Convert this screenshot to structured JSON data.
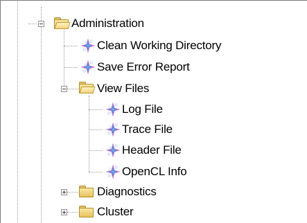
{
  "tree": {
    "items": [
      {
        "label": "Administration",
        "type": "folder",
        "expanded": true
      },
      {
        "label": "Clean Working Directory",
        "type": "action"
      },
      {
        "label": "Save Error Report",
        "type": "action"
      },
      {
        "label": "View Files",
        "type": "folder",
        "expanded": true
      },
      {
        "label": "Log File",
        "type": "action"
      },
      {
        "label": "Trace File",
        "type": "action"
      },
      {
        "label": "Header File",
        "type": "action"
      },
      {
        "label": "OpenCL Info",
        "type": "action"
      },
      {
        "label": "Diagnostics",
        "type": "folder",
        "expanded": false
      },
      {
        "label": "Cluster",
        "type": "folder",
        "expanded": false
      }
    ]
  },
  "colors": {
    "border": "#7a7a7a",
    "tree_lines": "#9a9a9a",
    "folder_fill": "#f3d27a",
    "folder_edge": "#b38d2c",
    "sparkle_blue": "#3f8ee0",
    "sparkle_pink": "#d66ad6"
  },
  "icons": {
    "expanded": "minus-box-icon",
    "collapsed": "plus-box-icon",
    "folder": "folder-icon",
    "folder_open": "open-folder-icon",
    "action": "sparkle-icon"
  }
}
